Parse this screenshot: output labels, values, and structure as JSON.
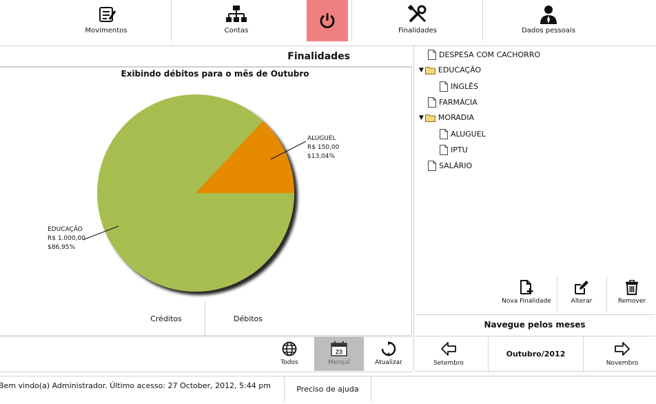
{
  "toolbar": {
    "movimentos": "Movimentos",
    "contas": "Contas",
    "finalidades": "Finalidades",
    "dados_pessoais": "Dados pessoais"
  },
  "page": {
    "title": "Finalidades",
    "chart_heading": "Exibindo débitos para o mês de Outubro"
  },
  "tabs": {
    "creditos": "Créditos",
    "debitos": "Débitos"
  },
  "view_buttons": {
    "todos": "Todos",
    "mensal": "Mensal",
    "mensal_icon_day": "23",
    "atualizar": "Atualizar"
  },
  "tree": [
    {
      "label": "DESPESA COM CACHORRO",
      "type": "file",
      "level": 0
    },
    {
      "label": "EDUCAÇÃO",
      "type": "folder",
      "level": 0
    },
    {
      "label": "INGLÊS",
      "type": "file",
      "level": 1
    },
    {
      "label": "FARMÁCIA",
      "type": "file",
      "level": 0
    },
    {
      "label": "MORADIA",
      "type": "folder",
      "level": 0
    },
    {
      "label": "ALUGUEL",
      "type": "file",
      "level": 1
    },
    {
      "label": "IPTU",
      "type": "file",
      "level": 1
    },
    {
      "label": "SALÁRIO",
      "type": "file",
      "level": 0
    }
  ],
  "actions": {
    "nova": "Nova Finalidade",
    "alterar": "Alterar",
    "remover": "Remover"
  },
  "month_nav": {
    "title": "Navegue pelos meses",
    "prev": "Setembro",
    "current": "Outubro/2012",
    "next": "Novembro"
  },
  "status": {
    "welcome": "Bem vindo(a) Administrador. Último acesso: 27 October, 2012, 5:44 pm",
    "help": "Preciso de ajuda"
  },
  "colors": {
    "power_bg": "#f08080",
    "educacao": "#a8bd50",
    "aluguel": "#e68a00",
    "mensal_active": "#bdbdbd"
  },
  "chart_data": {
    "type": "pie",
    "title": "Exibindo débitos para o mês de Outubro",
    "slices": [
      {
        "name": "ALUGUEL",
        "value_label": "R$ 150,00",
        "percent_label": "$13,04%",
        "value": 150.0,
        "percent": 13.04
      },
      {
        "name": "EDUCAÇÃO",
        "value_label": "R$ 1.000,00",
        "percent_label": "$86,95%",
        "value": 1000.0,
        "percent": 86.95
      }
    ]
  }
}
